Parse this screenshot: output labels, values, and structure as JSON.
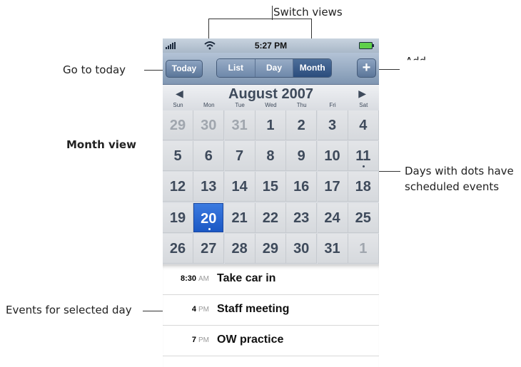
{
  "callouts": {
    "switch_views": "Switch views",
    "go_to_today": "Go to today",
    "add": "Add",
    "month_view": "Month view",
    "days_with_dots_1": "Days with dots have",
    "days_with_dots_2": "scheduled events",
    "events_for_day": "Events for selected day"
  },
  "status_bar": {
    "time": "5:27 PM"
  },
  "toolbar": {
    "today_label": "Today",
    "add_label": "+",
    "views": [
      {
        "label": "List",
        "active": false
      },
      {
        "label": "Day",
        "active": false
      },
      {
        "label": "Month",
        "active": true
      }
    ]
  },
  "calendar": {
    "month_title": "August 2007",
    "prev_arrow": "◀",
    "next_arrow": "▶",
    "weekdays": [
      "Sun",
      "Mon",
      "Tue",
      "Wed",
      "Thu",
      "Fri",
      "Sat"
    ],
    "weeks": [
      [
        {
          "d": "29",
          "muted": true
        },
        {
          "d": "30",
          "muted": true
        },
        {
          "d": "31",
          "muted": true
        },
        {
          "d": "1"
        },
        {
          "d": "2"
        },
        {
          "d": "3"
        },
        {
          "d": "4"
        }
      ],
      [
        {
          "d": "5"
        },
        {
          "d": "6"
        },
        {
          "d": "7"
        },
        {
          "d": "8"
        },
        {
          "d": "9"
        },
        {
          "d": "10"
        },
        {
          "d": "11",
          "dot": true
        }
      ],
      [
        {
          "d": "12"
        },
        {
          "d": "13"
        },
        {
          "d": "14"
        },
        {
          "d": "15"
        },
        {
          "d": "16"
        },
        {
          "d": "17"
        },
        {
          "d": "18"
        }
      ],
      [
        {
          "d": "19"
        },
        {
          "d": "20",
          "selected": true,
          "dot": true
        },
        {
          "d": "21"
        },
        {
          "d": "22"
        },
        {
          "d": "23"
        },
        {
          "d": "24"
        },
        {
          "d": "25"
        }
      ],
      [
        {
          "d": "26"
        },
        {
          "d": "27"
        },
        {
          "d": "28"
        },
        {
          "d": "29"
        },
        {
          "d": "30"
        },
        {
          "d": "31"
        },
        {
          "d": "1",
          "muted": true
        }
      ]
    ]
  },
  "events": [
    {
      "time": "8:30",
      "ampm": "AM",
      "title": "Take car in"
    },
    {
      "time": "4",
      "ampm": "PM",
      "title": "Staff meeting"
    },
    {
      "time": "7",
      "ampm": "PM",
      "title": "OW practice"
    }
  ]
}
